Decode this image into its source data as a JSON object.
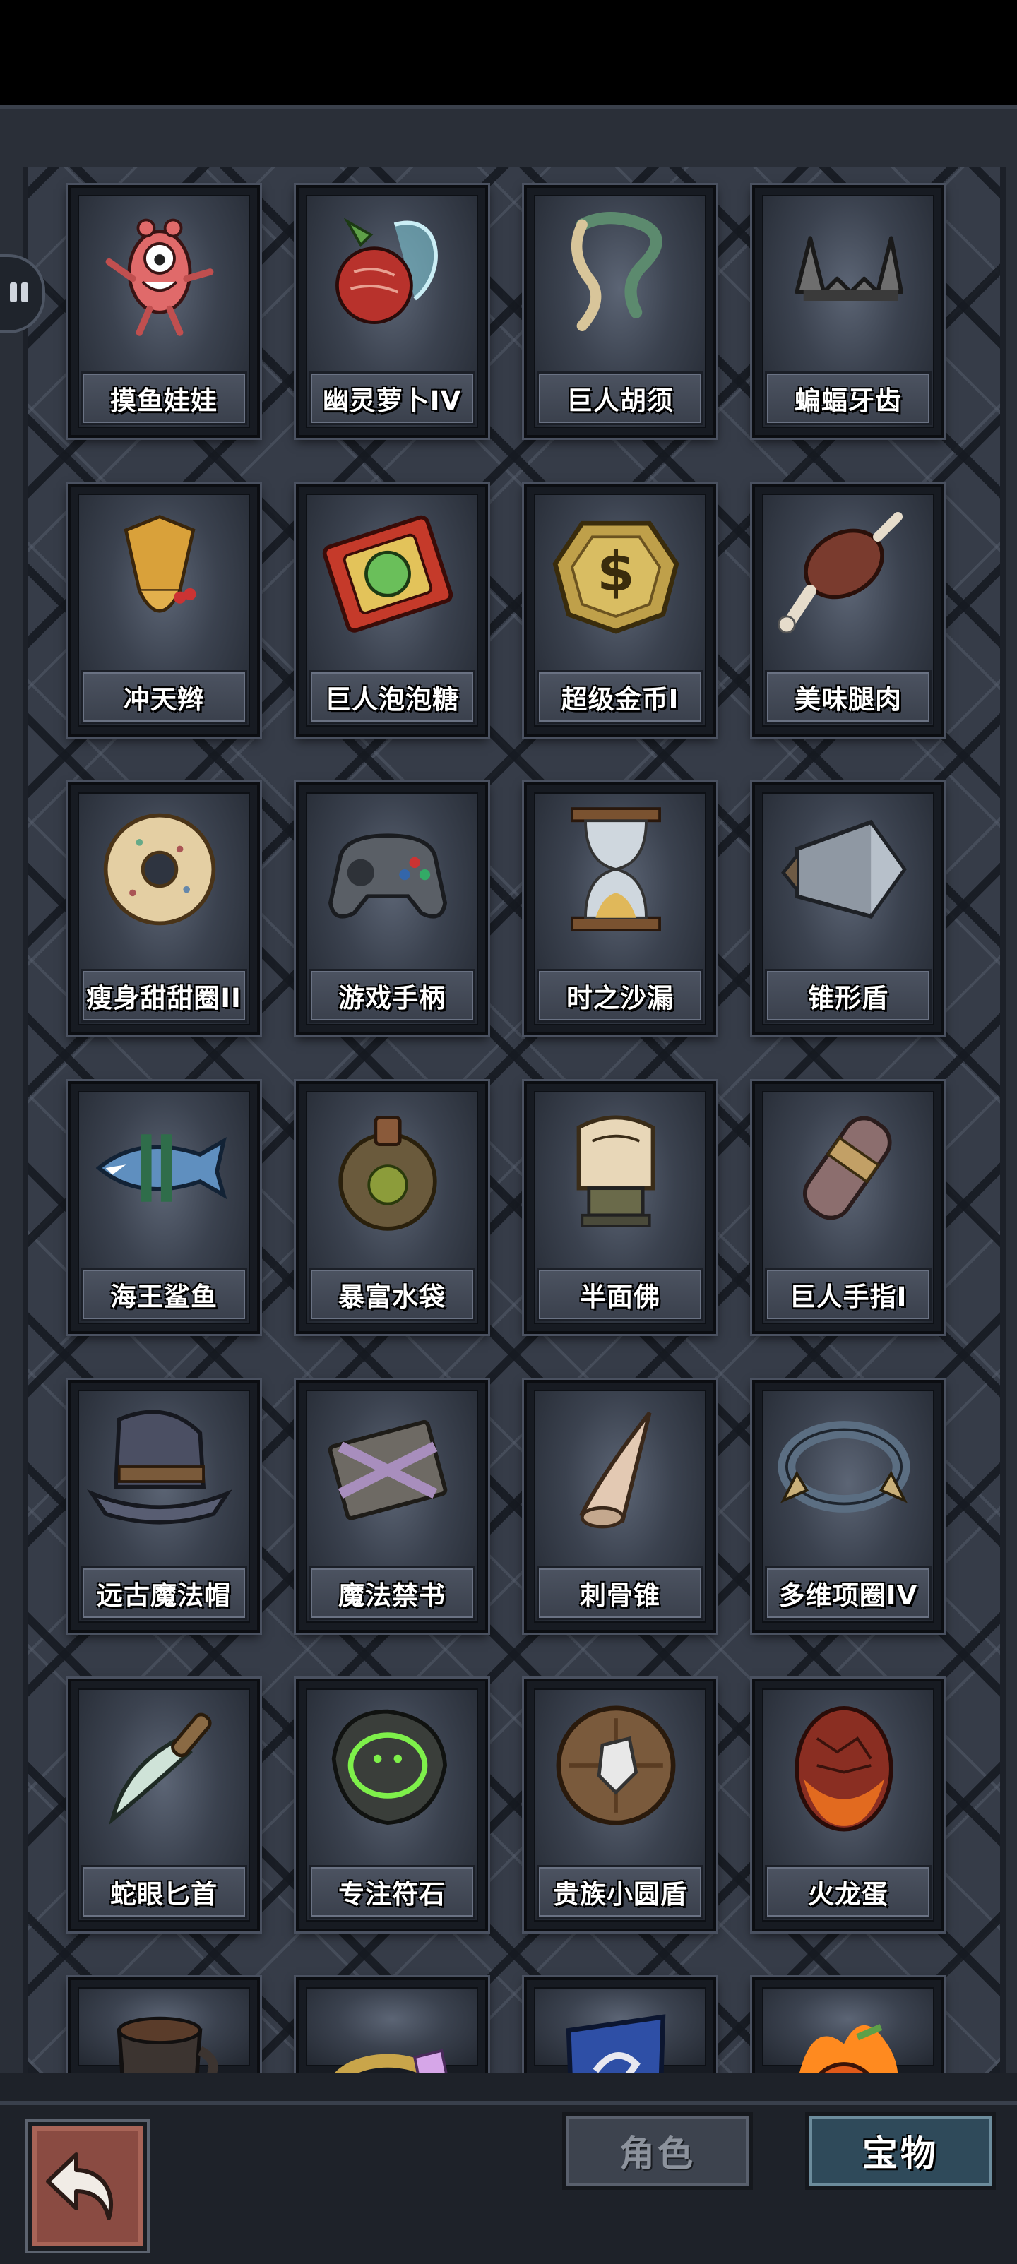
{
  "items": [
    {
      "label": "摸鱼娃娃",
      "icon": "pink-doll-icon"
    },
    {
      "label": "幽灵萝卜IV",
      "icon": "ghost-radish-icon"
    },
    {
      "label": "巨人胡须",
      "icon": "giant-beard-icon"
    },
    {
      "label": "蝙蝠牙齿",
      "icon": "bat-teeth-icon"
    },
    {
      "label": "冲天辫",
      "icon": "pigtail-icon"
    },
    {
      "label": "巨人泡泡糖",
      "icon": "bubble-gum-icon"
    },
    {
      "label": "超级金币I",
      "icon": "gold-coin-icon"
    },
    {
      "label": "美味腿肉",
      "icon": "meat-leg-icon"
    },
    {
      "label": "瘦身甜甜圈II",
      "icon": "donut-icon"
    },
    {
      "label": "游戏手柄",
      "icon": "gamepad-icon"
    },
    {
      "label": "时之沙漏",
      "icon": "hourglass-icon"
    },
    {
      "label": "锥形盾",
      "icon": "cone-shield-icon"
    },
    {
      "label": "海王鲨鱼",
      "icon": "shark-icon"
    },
    {
      "label": "暴富水袋",
      "icon": "water-bag-icon"
    },
    {
      "label": "半面佛",
      "icon": "buddha-fist-icon"
    },
    {
      "label": "巨人手指I",
      "icon": "giant-finger-icon"
    },
    {
      "label": "远古魔法帽",
      "icon": "wizard-hat-icon"
    },
    {
      "label": "魔法禁书",
      "icon": "forbidden-book-icon"
    },
    {
      "label": "刺骨锥",
      "icon": "bone-spike-icon"
    },
    {
      "label": "多维项圈IV",
      "icon": "collar-icon"
    },
    {
      "label": "蛇眼匕首",
      "icon": "dagger-icon"
    },
    {
      "label": "专注符石",
      "icon": "rune-stone-icon"
    },
    {
      "label": "贵族小圆盾",
      "icon": "round-shield-icon"
    },
    {
      "label": "火龙蛋",
      "icon": "dragon-egg-icon"
    },
    {
      "label": "",
      "icon": "mug-icon"
    },
    {
      "label": "",
      "icon": "ring-icon"
    },
    {
      "label": "",
      "icon": "dragon-crest-shield-icon"
    },
    {
      "label": "",
      "icon": "fire-pumpkin-icon"
    }
  ],
  "tabs": {
    "role": "角色",
    "treasure": "宝物"
  },
  "colors": {
    "gold": "#c8a14a",
    "meat": "#7a3b2e",
    "lava": "#d8431f",
    "steel": "#8f98a3"
  }
}
